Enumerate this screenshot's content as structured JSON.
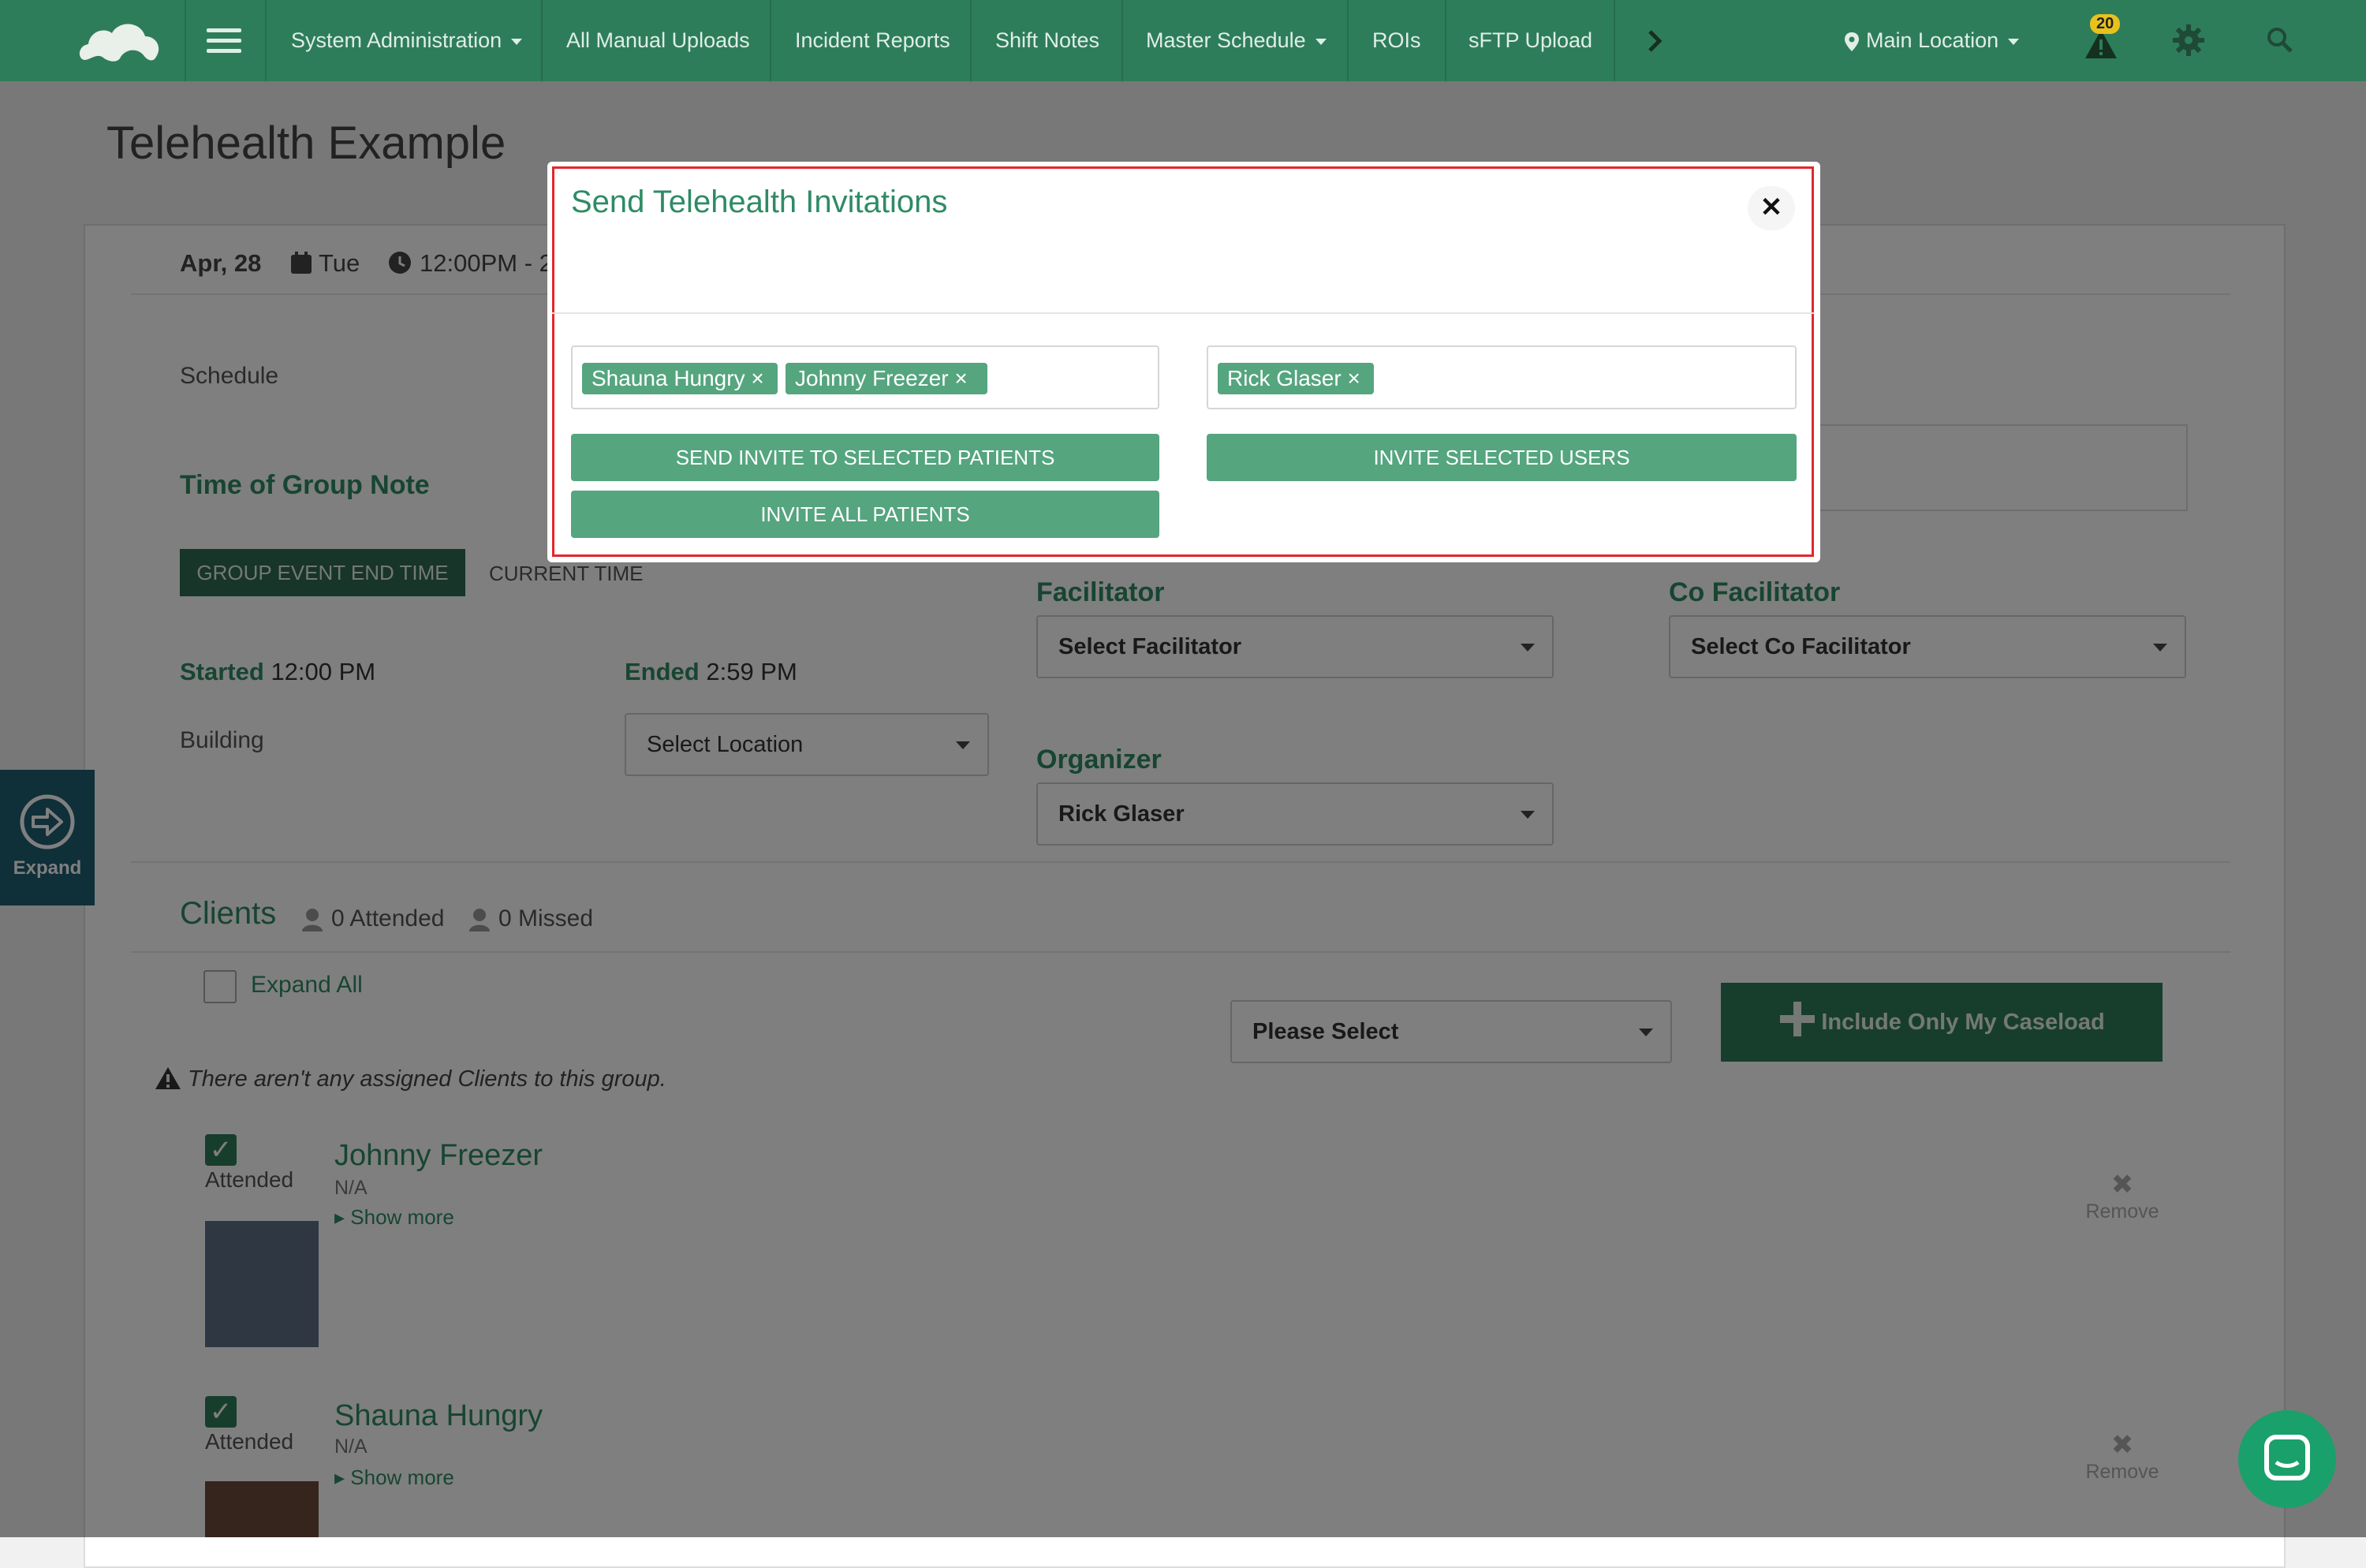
{
  "nav": {
    "items": [
      {
        "label": "System Administration",
        "dropdown": true
      },
      {
        "label": "All Manual Uploads"
      },
      {
        "label": "Incident Reports"
      },
      {
        "label": "Shift Notes"
      },
      {
        "label": "Master Schedule",
        "dropdown": true
      },
      {
        "label": "ROIs"
      },
      {
        "label": "sFTP Upload"
      }
    ],
    "location": "Main Location",
    "alert_count": "20",
    "colors": {
      "bar": "#2e7d5a",
      "accent": "#55a57f"
    }
  },
  "page": {
    "title": "Telehealth Example",
    "date": "Apr, 28",
    "weekday": "Tue",
    "time": "12:00PM - 2",
    "schedule_label": "Schedule",
    "time_of_group_note": "Time of Group Note",
    "btn_group_end": "GROUP EVENT END TIME",
    "btn_current_time": "CURRENT TIME",
    "started_label": "Started",
    "started_value": "12:00 PM",
    "ended_label": "Ended",
    "ended_value": "2:59 PM",
    "building_label": "Building",
    "location_placeholder": "Select Location",
    "facilitator_label": "Facilitator",
    "facilitator_placeholder": "Select Facilitator",
    "co_facilitator_label": "Co Facilitator",
    "co_facilitator_placeholder": "Select Co Facilitator",
    "organizer_label": "Organizer",
    "organizer_value": "Rick Glaser",
    "clients_label": "Clients",
    "attended_count": "0 Attended",
    "missed_count": "0 Missed",
    "expand_all": "Expand All",
    "please_select": "Please Select",
    "include_caseload": "Include Only My Caseload",
    "no_clients_warning": "There aren't any assigned Clients to this group.",
    "expand_tab": "Expand",
    "clients": [
      {
        "name": "Johnny Freezer",
        "status": "Attended",
        "sub": "N/A",
        "show_more": "Show more",
        "remove": "Remove"
      },
      {
        "name": "Shauna Hungry",
        "status": "Attended",
        "sub": "N/A",
        "show_more": "Show more",
        "remove": "Remove"
      }
    ]
  },
  "modal": {
    "title": "Send Telehealth Invitations",
    "patients": [
      "Shauna Hungry",
      "Johnny Freezer"
    ],
    "users": [
      "Rick Glaser"
    ],
    "btn_send_selected": "SEND INVITE TO SELECTED PATIENTS",
    "btn_invite_all": "INVITE ALL PATIENTS",
    "btn_invite_users": "INVITE SELECTED USERS"
  }
}
